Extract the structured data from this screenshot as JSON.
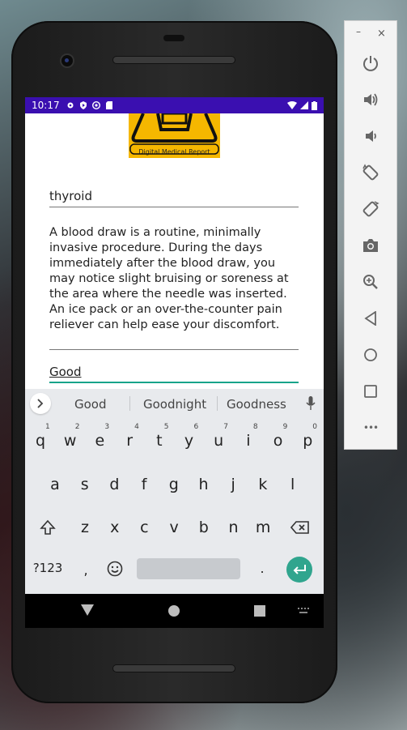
{
  "status_bar": {
    "time": "10:17"
  },
  "logo": {
    "text": "Digital Medical Report"
  },
  "form": {
    "test_name": "thyroid",
    "description": "A blood draw is a routine, minimally invasive procedure. During the days immediately after the blood draw, you may notice slight bruising or soreness at the area where the needle was inserted. An ice pack or an over-the-counter pain reliever can help ease your discomfort.",
    "condition": "Good"
  },
  "keyboard": {
    "suggestions": [
      "Good",
      "Goodnight",
      "Goodness"
    ],
    "row1": [
      "q",
      "w",
      "e",
      "r",
      "t",
      "y",
      "u",
      "i",
      "o",
      "p"
    ],
    "row1_nums": [
      "1",
      "2",
      "3",
      "4",
      "5",
      "6",
      "7",
      "8",
      "9",
      "0"
    ],
    "row2": [
      "a",
      "s",
      "d",
      "f",
      "g",
      "h",
      "j",
      "k",
      "l"
    ],
    "row3": [
      "z",
      "x",
      "c",
      "v",
      "b",
      "n",
      "m"
    ],
    "symbols_key": "?123",
    "comma": ",",
    "period": "."
  },
  "emulator_controls": {
    "minimize": "–",
    "close": "×",
    "more": "•••",
    "icons": [
      "power-icon",
      "volume-up-icon",
      "volume-down-icon",
      "rotate-left-icon",
      "rotate-right-icon",
      "camera-icon",
      "zoom-icon",
      "back-icon",
      "home-icon",
      "overview-icon"
    ]
  }
}
